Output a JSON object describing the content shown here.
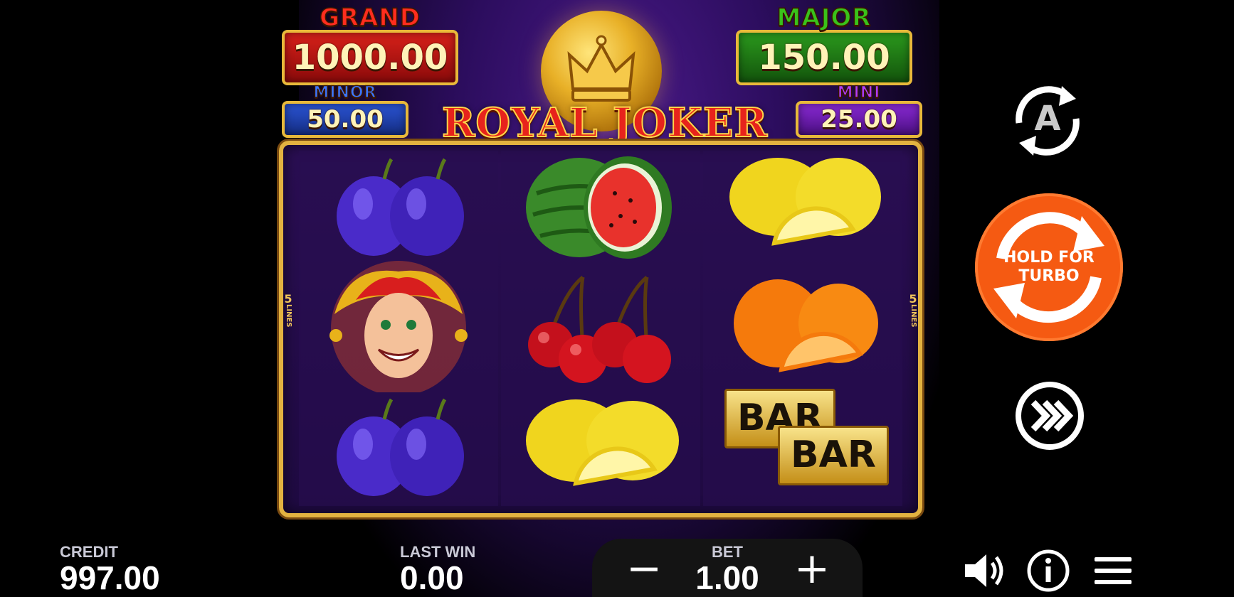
{
  "jackpots": {
    "grand": {
      "name": "GRAND",
      "value": "1000.00",
      "box_color": "#b50f12",
      "name_color": "#ff2d1e"
    },
    "major": {
      "name": "MAJOR",
      "value": "150.00",
      "box_color": "#1d7a14",
      "name_color": "#39c21b"
    },
    "minor": {
      "name": "MINOR",
      "value": "50.00",
      "box_color": "#1c3fb0",
      "name_color": "#3c76ff"
    },
    "mini": {
      "name": "MINI",
      "value": "25.00",
      "box_color": "#6a1aa8",
      "name_color": "#b03cff"
    }
  },
  "logo": {
    "text": "ROYAL JOKER"
  },
  "reels": {
    "lines_label": {
      "number": "5",
      "word": "LINES"
    },
    "columns": [
      [
        "plum",
        "joker",
        "plum"
      ],
      [
        "watermelon",
        "cherry",
        "lemon"
      ],
      [
        "lemon",
        "orange",
        "bar"
      ]
    ],
    "bar_text": "BAR"
  },
  "controls": {
    "spin_label_line1": "HOLD FOR",
    "spin_label_line2": "TURBO",
    "autoplay_letter": "A"
  },
  "footer": {
    "credit_label": "CREDIT",
    "credit_value": "997.00",
    "last_win_label": "LAST WIN",
    "last_win_value": "0.00",
    "bet_label": "BET",
    "bet_value": "1.00",
    "minus": "−",
    "plus": "+"
  },
  "icons": {
    "autoplay": "autoplay-icon",
    "spin": "spin-arrows-icon",
    "turbo": "fast-forward-icon",
    "sound": "speaker-icon",
    "info": "info-icon",
    "menu": "hamburger-menu-icon"
  },
  "colors": {
    "spin": "#f55a12",
    "frame": "#e3b240",
    "background": "#000000"
  }
}
